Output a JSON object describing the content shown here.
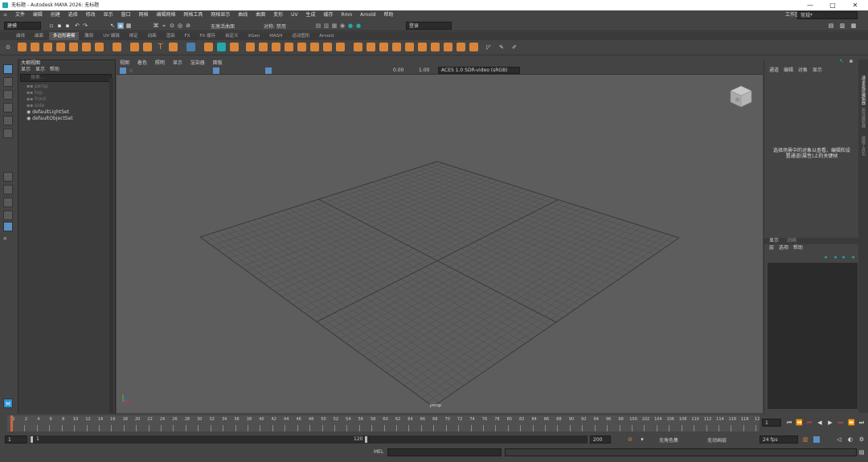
{
  "window": {
    "title": "无标题 - Autodesk MAYA 2026: 无标题",
    "minimize": "—",
    "maximize": "□",
    "close": "✕"
  },
  "menu": [
    "文件",
    "编辑",
    "创建",
    "选择",
    "修改",
    "显示",
    "窗口",
    "网格",
    "编辑网格",
    "网格工具",
    "网格显示",
    "曲线",
    "曲面",
    "变形",
    "UV",
    "生成",
    "缓存",
    "Rmn",
    "Arnold",
    "帮助"
  ],
  "workspace": {
    "label": "工作区:",
    "value": "常规*"
  },
  "statusline": {
    "mode": "建模",
    "live_surface": "无激活曲面",
    "symmetry": "对称: 禁用",
    "login": "登录"
  },
  "shelf_tabs": [
    "曲线",
    "曲面",
    "多边形建模",
    "雕刻",
    "UV 编辑",
    "绑定",
    "动画",
    "渲染",
    "FX",
    "FX 缓存",
    "自定义",
    "XGen",
    "MASH",
    "运动图形",
    "Arnold"
  ],
  "shelf_active": "多边形建模",
  "outliner": {
    "title": "大纲视图",
    "menu": [
      "显示",
      "显示",
      "帮助"
    ],
    "search_placeholder": "搜索...",
    "items": [
      "persp",
      "top",
      "front",
      "side",
      "defaultLightSet",
      "defaultObjectSet"
    ]
  },
  "viewport": {
    "menu": [
      "视图",
      "着色",
      "照明",
      "显示",
      "渲染器",
      "面板"
    ],
    "exposure": "0.00",
    "gamma": "1.00",
    "color_space": "ACES 1.0 SDR-video (sRGB)",
    "camera_label": "persp",
    "viewcube_label": "前"
  },
  "channel_box": {
    "menu": [
      "通道",
      "编辑",
      "对象",
      "显示"
    ],
    "empty_message_line1": "选择场景中的对象以查看、编辑和设",
    "empty_message_line2": "置通道(属性)上的关键帧"
  },
  "layer_editor": {
    "tabs": [
      "显示",
      "动画"
    ],
    "menu": [
      "层",
      "选项",
      "帮助"
    ]
  },
  "side_tabs": [
    "通道盒/层编辑器",
    "属性编辑器",
    "建模工具包"
  ],
  "timeline": {
    "ticks": [
      "1",
      "2",
      "4",
      "6",
      "8",
      "10",
      "12",
      "14",
      "16",
      "18",
      "20",
      "22",
      "24",
      "26",
      "28",
      "30",
      "32",
      "34",
      "36",
      "38",
      "40",
      "42",
      "44",
      "46",
      "48",
      "50",
      "52",
      "54",
      "56",
      "58",
      "60",
      "62",
      "64",
      "66",
      "68",
      "70",
      "72",
      "74",
      "76",
      "78",
      "80",
      "82",
      "84",
      "86",
      "88",
      "90",
      "92",
      "94",
      "96",
      "98",
      "100",
      "102",
      "104",
      "106",
      "108",
      "110",
      "112",
      "114",
      "116",
      "118",
      "12"
    ],
    "current_frame": "1"
  },
  "range": {
    "start": "1",
    "inner_start": "1",
    "inner_end": "120",
    "end": "200",
    "character_set": "无角色集",
    "anim_layer": "无动画层",
    "fps": "24 fps"
  },
  "command": {
    "language": "MEL"
  },
  "colors": {
    "accent": "#d8853a",
    "selected_tool": "#5b8fc2"
  }
}
